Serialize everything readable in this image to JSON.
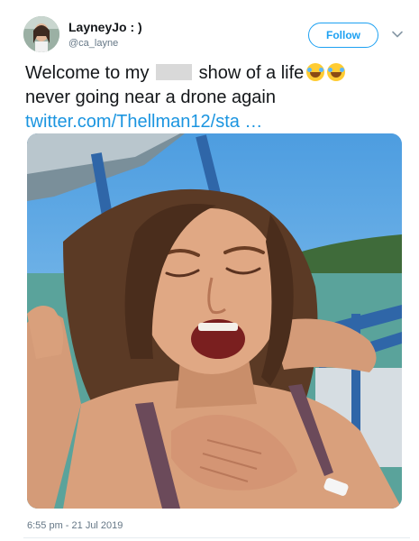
{
  "user": {
    "display_name": "LayneyJo : )",
    "handle": "@ca_layne"
  },
  "follow_label": "Follow",
  "tweet": {
    "text_part1": "Welcome to my",
    "text_part2": "show of a life",
    "text_line2": "never going near a drone again",
    "link_text": "twitter.com/Thellman12/sta …"
  },
  "timestamp": "6:55 pm - 21 Jul 2019",
  "colors": {
    "accent": "#1da1f2",
    "link": "#1b95e0",
    "muted": "#657786"
  },
  "icons": {
    "menu": "chevron-down-icon",
    "emoji": "face-with-tears-of-joy-emoji"
  }
}
